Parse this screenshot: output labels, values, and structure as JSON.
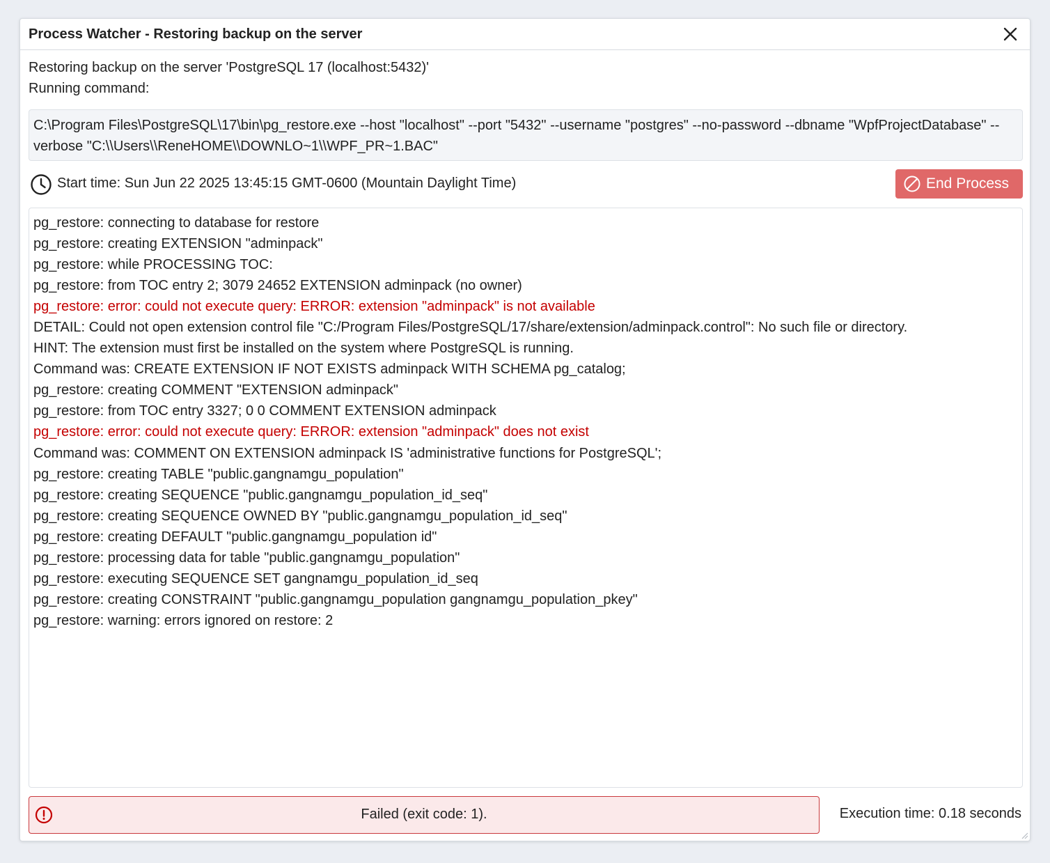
{
  "dialog": {
    "title": "Process Watcher - Restoring backup on the server",
    "close_icon": "close-icon"
  },
  "info": {
    "restoring_line": "Restoring backup on the server 'PostgreSQL 17 (localhost:5432)'",
    "running_label": "Running command:"
  },
  "command": {
    "text": "C:\\Program Files\\PostgreSQL\\17\\bin\\pg_restore.exe --host \"localhost\" --port \"5432\" --username \"postgres\" --no-password --dbname \"WpfProjectDatabase\" --verbose \"C:\\\\Users\\\\ReneHOME\\\\DOWNLO~1\\\\WPF_PR~1.BAC\""
  },
  "start": {
    "icon": "clock-icon",
    "text": "Start time: Sun Jun 22 2025 13:45:15 GMT-0600 (Mountain Daylight Time)"
  },
  "end_button": {
    "icon": "ban-icon",
    "label": "End Process",
    "color": "#e06868"
  },
  "log": {
    "lines": [
      {
        "text": "pg_restore: connecting to database for restore",
        "error": false
      },
      {
        "text": "pg_restore: creating EXTENSION \"adminpack\"",
        "error": false
      },
      {
        "text": "pg_restore: while PROCESSING TOC:",
        "error": false
      },
      {
        "text": "pg_restore: from TOC entry 2; 3079 24652 EXTENSION adminpack (no owner)",
        "error": false
      },
      {
        "text": "pg_restore: error: could not execute query: ERROR: extension \"adminpack\" is not available",
        "error": true
      },
      {
        "text": "DETAIL: Could not open extension control file \"C:/Program Files/PostgreSQL/17/share/extension/adminpack.control\": No such file or directory.",
        "error": false
      },
      {
        "text": "HINT: The extension must first be installed on the system where PostgreSQL is running.",
        "error": false
      },
      {
        "text": "Command was: CREATE EXTENSION IF NOT EXISTS adminpack WITH SCHEMA pg_catalog;",
        "error": false
      },
      {
        "text": "pg_restore: creating COMMENT \"EXTENSION adminpack\"",
        "error": false
      },
      {
        "text": "pg_restore: from TOC entry 3327; 0 0 COMMENT EXTENSION adminpack",
        "error": false
      },
      {
        "text": "pg_restore: error: could not execute query: ERROR: extension \"adminpack\" does not exist",
        "error": true
      },
      {
        "text": "Command was: COMMENT ON EXTENSION adminpack IS 'administrative functions for PostgreSQL';",
        "error": false
      },
      {
        "text": "pg_restore: creating TABLE \"public.gangnamgu_population\"",
        "error": false
      },
      {
        "text": "pg_restore: creating SEQUENCE \"public.gangnamgu_population_id_seq\"",
        "error": false
      },
      {
        "text": "pg_restore: creating SEQUENCE OWNED BY \"public.gangnamgu_population_id_seq\"",
        "error": false
      },
      {
        "text": "pg_restore: creating DEFAULT \"public.gangnamgu_population id\"",
        "error": false
      },
      {
        "text": "pg_restore: processing data for table \"public.gangnamgu_population\"",
        "error": false
      },
      {
        "text": "pg_restore: executing SEQUENCE SET gangnamgu_population_id_seq",
        "error": false
      },
      {
        "text": "pg_restore: creating CONSTRAINT \"public.gangnamgu_population gangnamgu_population_pkey\"",
        "error": false
      },
      {
        "text": "pg_restore: warning: errors ignored on restore: 2",
        "error": false
      }
    ],
    "error_color": "#c40000"
  },
  "status": {
    "icon": "exclamation-circle-icon",
    "text": "Failed (exit code: 1).",
    "color": "#c9393d"
  },
  "execution": {
    "text": "Execution time: 0.18 seconds"
  }
}
